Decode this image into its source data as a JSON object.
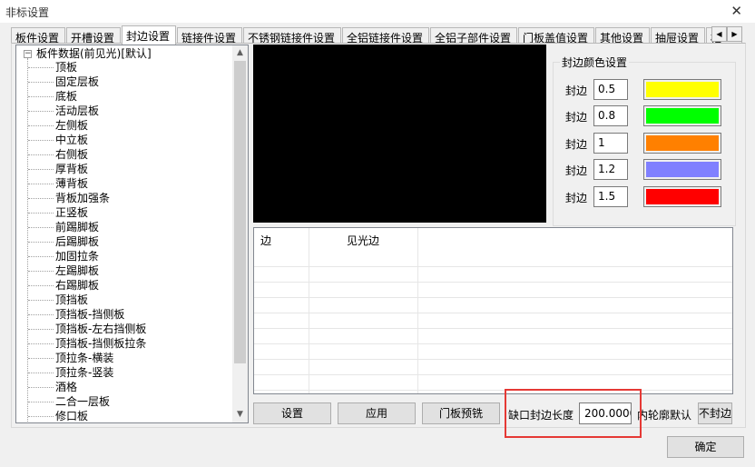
{
  "window": {
    "title": "非标设置",
    "close_glyph": "✕"
  },
  "tabs": [
    "板件设置",
    "开槽设置",
    "封边设置",
    "链接件设置",
    "不锈钢链接件设置",
    "全铝链接件设置",
    "全铝子部件设置",
    "门板盖值设置",
    "其他设置",
    "抽屉设置",
    "柜"
  ],
  "active_tab": "封边设置",
  "tab_scroll": {
    "left": "◀",
    "right": "▶"
  },
  "tree": {
    "root": {
      "expander": "−",
      "label": "板件数据(前见光)[默认]"
    },
    "items": [
      "顶板",
      "固定层板",
      "底板",
      "活动层板",
      "左侧板",
      "中立板",
      "右侧板",
      "厚背板",
      "薄背板",
      "背板加强条",
      "正竖板",
      "前踢脚板",
      "后踢脚板",
      "加固拉条",
      "左踢脚板",
      "右踢脚板",
      "顶挡板",
      "顶挡板-挡侧板",
      "顶挡板-左右挡侧板",
      "顶挡板-挡侧板拉条",
      "顶拉条-横装",
      "顶拉条-竖装",
      "酒格",
      "二合一层板",
      "修口板"
    ],
    "scroll_up": "▲",
    "scroll_down": "▼"
  },
  "edge_colors": {
    "legend": "封边颜色设置",
    "rows": [
      {
        "label": "封边",
        "value": "0.5",
        "color": "#ffff00"
      },
      {
        "label": "封边",
        "value": "0.8",
        "color": "#00ff00"
      },
      {
        "label": "封边",
        "value": "1",
        "color": "#ff8000"
      },
      {
        "label": "封边",
        "value": "1.2",
        "color": "#8080ff"
      },
      {
        "label": "封边",
        "value": "1.5",
        "color": "#ff0000"
      }
    ]
  },
  "grid": {
    "columns": [
      "边",
      "见光边"
    ]
  },
  "buttons": {
    "settings": "设置",
    "apply": "应用",
    "door_mill": "门板预铣",
    "no_edge": "不封边",
    "ok": "确定"
  },
  "notch": {
    "label": "缺口封边长度",
    "value": "200.0000",
    "outline_default": "内轮廓默认"
  },
  "colors": {
    "highlight": "#e53935",
    "preview_bg": "#000000"
  }
}
